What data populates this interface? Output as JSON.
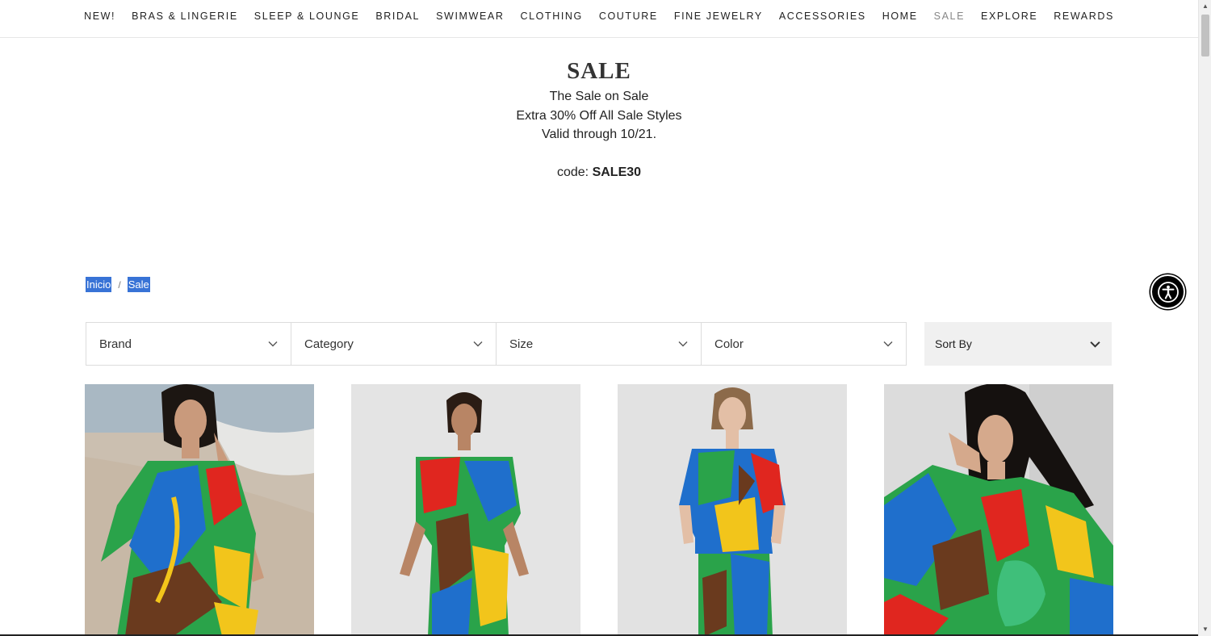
{
  "nav": {
    "items": [
      {
        "label": "NEW!"
      },
      {
        "label": "BRAS & LINGERIE"
      },
      {
        "label": "SLEEP & LOUNGE"
      },
      {
        "label": "BRIDAL"
      },
      {
        "label": "SWIMWEAR"
      },
      {
        "label": "CLOTHING"
      },
      {
        "label": "COUTURE"
      },
      {
        "label": "FINE JEWELRY"
      },
      {
        "label": "ACCESSORIES"
      },
      {
        "label": "HOME"
      },
      {
        "label": "SALE",
        "active": true
      },
      {
        "label": "EXPLORE"
      },
      {
        "label": "REWARDS"
      }
    ]
  },
  "promo": {
    "title": "SALE",
    "line1": "The Sale on Sale",
    "line2": "Extra 30% Off All Sale Styles",
    "line3": "Valid through 10/21.",
    "code_label": "code: ",
    "code_value": "SALE30"
  },
  "breadcrumb": {
    "home": "Inicio",
    "separator": "/",
    "current": "Sale"
  },
  "filters": {
    "brand": "Brand",
    "category": "Category",
    "size": "Size",
    "color": "Color",
    "sort": "Sort By"
  },
  "colors": {
    "selection": "#3873d6",
    "accent_inactive": "#888888"
  }
}
